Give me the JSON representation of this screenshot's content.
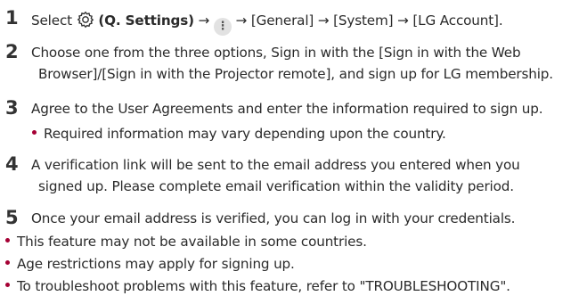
{
  "steps": [
    {
      "num": "1",
      "select": "Select",
      "qsettings": "(Q. Settings)",
      "arrow": "→",
      "general": "[General]",
      "system": "[System]",
      "lg_account": "[LG Account]."
    },
    {
      "num": "2",
      "line1": "Choose one from the three options, Sign in with the [Sign in with the Web",
      "line2": "Browser]/[Sign in with the Projector remote], and sign up for LG membership."
    },
    {
      "num": "3",
      "line1": "Agree to the User Agreements and enter the information required to sign up.",
      "sub_bullet": "Required information may vary depending upon the country."
    },
    {
      "num": "4",
      "line1": "A verification link will be sent to the email address you entered when you",
      "line2": "signed up. Please complete email verification within the validity period."
    },
    {
      "num": "5",
      "line1": "Once your email address is verified, you can log in with your credentials."
    }
  ],
  "notes": [
    "This feature may not be available in some countries.",
    "Age restrictions may apply for signing up.",
    "To troubleshoot problems with this feature, refer to \"TROUBLESHOOTING\"."
  ],
  "icons": {
    "settings": "gear-icon",
    "more": "more-options-icon"
  },
  "colors": {
    "bullet": "#a50034",
    "text": "#2a2a2a"
  }
}
